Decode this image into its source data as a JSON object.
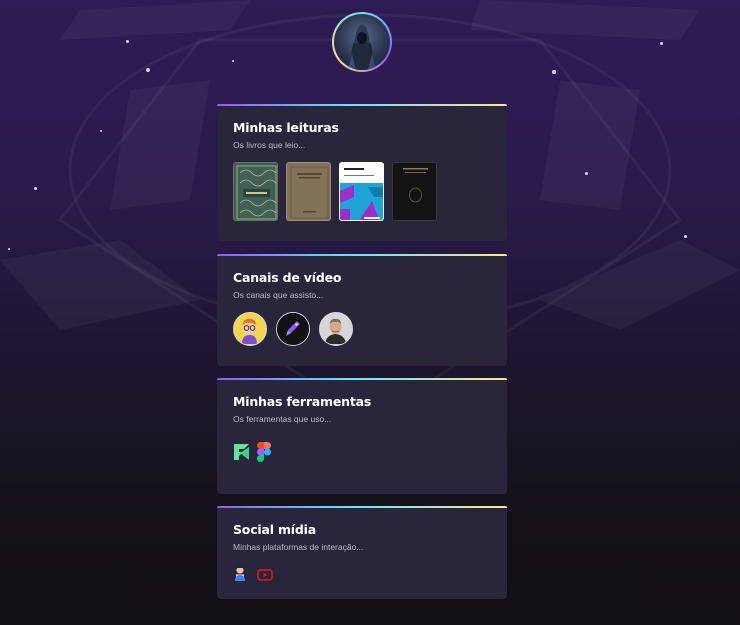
{
  "profile": {
    "avatar_icon": "hooded-figure-avatar"
  },
  "sections": [
    {
      "title": "Minhas leituras",
      "subtitle": "Os livros que leio..."
    },
    {
      "title": "Canais de vídeo",
      "subtitle": "Os canais que assisto..."
    },
    {
      "title": "Minhas ferramentas",
      "subtitle": "Os ferramentas que uso..."
    },
    {
      "title": "Social mídia",
      "subtitle": "Minhas plataformas de interação..."
    }
  ],
  "books": [
    {
      "cover_icon": "ornate-green-book-cover"
    },
    {
      "cover_icon": "vintage-beige-book-cover"
    },
    {
      "cover_icon": "colorful-pattern-book-cover",
      "title_text": "Refactoring",
      "author_text": "Martin Fowler"
    },
    {
      "cover_icon": "black-book-cover",
      "title_text": "THE PROPHET",
      "author_text": "KAHLIL GIBRAN"
    }
  ],
  "channels": [
    {
      "icon": "cartoon-glasses-avatar"
    },
    {
      "icon": "purple-rocket-avatar"
    },
    {
      "icon": "man-photo-avatar"
    }
  ],
  "tools": [
    {
      "icon": "frontend-mentor-icon"
    },
    {
      "icon": "figma-icon"
    }
  ],
  "social": [
    {
      "icon": "person-avatar-icon"
    },
    {
      "icon": "youtube-icon"
    }
  ],
  "colors": {
    "card_bg": "#29253a",
    "accent_purple": "#8b5cf6",
    "accent_cyan": "#63e3ff",
    "accent_yellow": "#fde68a",
    "youtube_red": "#e11d1d"
  }
}
